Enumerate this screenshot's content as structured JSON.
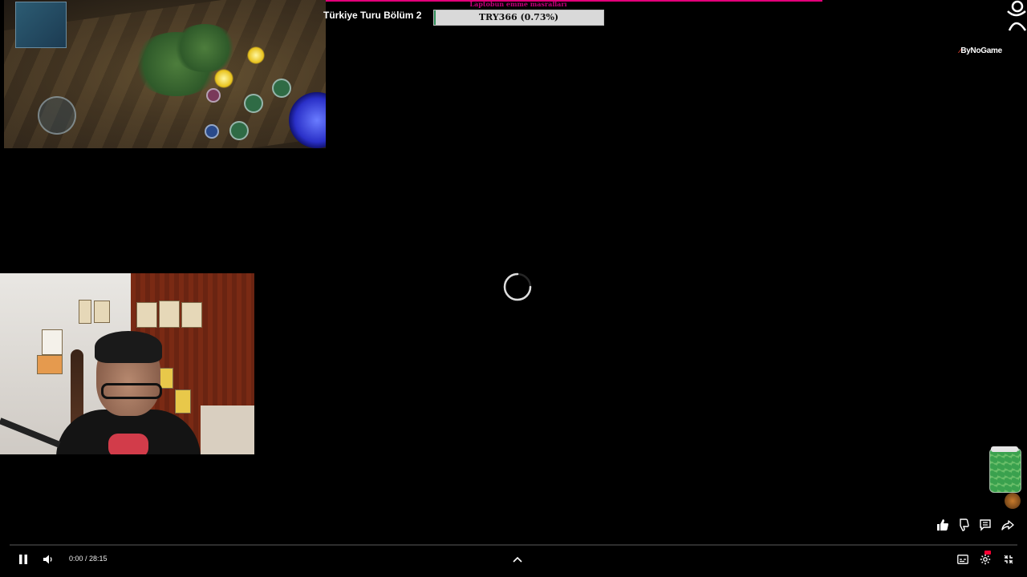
{
  "stream": {
    "title": "Türkiye Turu Bölüm 2",
    "goal_label": "Laptobun emme masrafları",
    "goal_text": "TRY366 (0.73%)",
    "goal_fraction": 0.0073,
    "brand_name": "ByNoGame",
    "brand_mark": "⁄"
  },
  "player": {
    "time": "0:00 / 28:15",
    "progress_fraction": 0,
    "accent_color": "#ff0033",
    "state": "loading",
    "goal_color": "#c3007a"
  },
  "icons": {
    "pause": "pause-icon",
    "volume": "volume-icon",
    "chevron": "chevron-up-icon",
    "subtitles": "subtitles-icon",
    "settings": "settings-icon",
    "exit_fullscreen": "exit-fullscreen-icon",
    "like": "like-icon",
    "dislike": "dislike-icon",
    "comments": "comments-icon",
    "share": "share-icon",
    "spinner": "loading-spinner-icon"
  }
}
